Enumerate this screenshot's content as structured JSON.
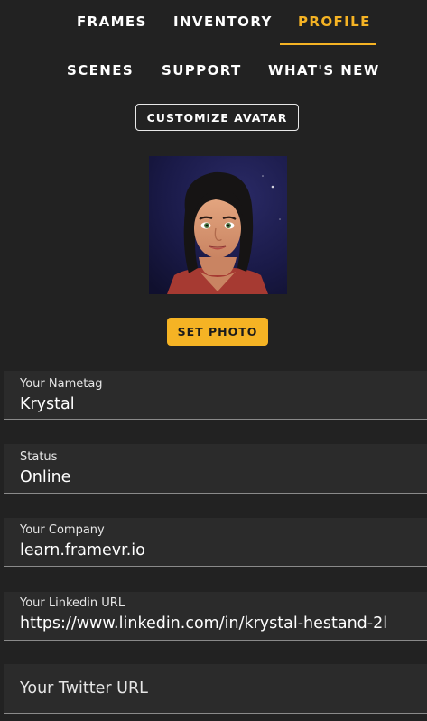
{
  "nav": {
    "row1": [
      {
        "label": "FRAMES"
      },
      {
        "label": "INVENTORY"
      },
      {
        "label": "PROFILE"
      }
    ],
    "row2": [
      {
        "label": "SCENES"
      },
      {
        "label": "SUPPORT"
      },
      {
        "label": "WHAT'S NEW"
      }
    ],
    "active_tab": "PROFILE"
  },
  "profile": {
    "customize_avatar_label": "CUSTOMIZE AVATAR",
    "set_photo_label": "SET PHOTO",
    "avatar_icon": "avatar-portrait",
    "fields": [
      {
        "label": "Your Nametag",
        "value": "Krystal"
      },
      {
        "label": "Status",
        "value": "Online"
      },
      {
        "label": "Your Company",
        "value": "learn.framevr.io"
      },
      {
        "label": "Your Linkedin URL",
        "value": "https://www.linkedin.com/in/krystal-hestand-2l"
      },
      {
        "placeholder": "Your Twitter URL"
      }
    ]
  },
  "colors": {
    "background": "#222222",
    "field_background": "#2b2b2b",
    "accent": "#f5b324",
    "text": "#ffffff"
  }
}
